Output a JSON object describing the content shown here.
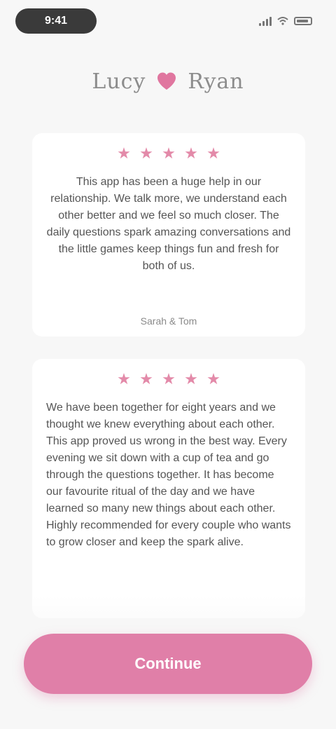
{
  "status_bar": {
    "time": "9:41"
  },
  "header": {
    "left_word": "Lucy",
    "right_word": "Ryan",
    "heart_icon": "heart-icon",
    "heart_color": "#e0769f"
  },
  "reviews": [
    {
      "stars": 5,
      "star_color": "#e38aa9",
      "text": "This app has been a huge help in our relationship. We talk more, we understand each other better and we feel so much closer. The daily questions spark amazing conversations and the little games keep things fun and fresh for both of us.",
      "reviewer": "Sarah & Tom"
    },
    {
      "stars": 5,
      "star_color": "#e38aa9",
      "text": "We have been together for eight years and we thought we knew everything about each other. This app proved us wrong in the best way. Every evening we sit down with a cup of tea and go through the questions together. It has become our favourite ritual of the day and we have learned so many new things about each other. Highly recommended for every couple who wants to grow closer and keep the spark alive.",
      "reviewer": ""
    }
  ],
  "cta": {
    "label": "Continue",
    "color": "#e07fa8"
  }
}
